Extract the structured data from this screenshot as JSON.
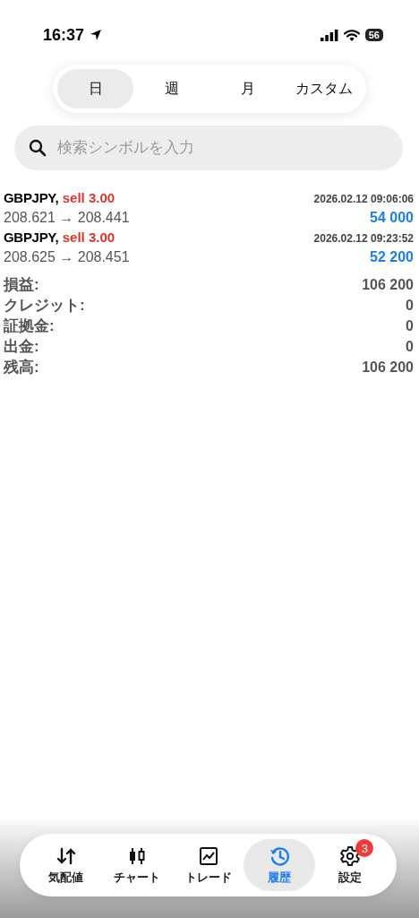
{
  "status_bar": {
    "time": "16:37",
    "battery": "56"
  },
  "period_tabs": [
    {
      "label": "日",
      "selected": true
    },
    {
      "label": "週",
      "selected": false
    },
    {
      "label": "月",
      "selected": false
    },
    {
      "label": "カスタム",
      "selected": false
    }
  ],
  "search": {
    "placeholder": "検索シンボルを入力"
  },
  "deals": [
    {
      "symbol": "GBPJPY,",
      "side": "sell 3.00",
      "time": "2026.02.12 09:06:06",
      "prices": "208.621 → 208.441",
      "profit": "54 000"
    },
    {
      "symbol": "GBPJPY,",
      "side": "sell 3.00",
      "time": "2026.02.12 09:23:52",
      "prices": "208.625 → 208.451",
      "profit": "52 200"
    }
  ],
  "summary": [
    {
      "label": "損益:",
      "value": "106 200"
    },
    {
      "label": "クレジット:",
      "value": "0"
    },
    {
      "label": "証拠金:",
      "value": "0"
    },
    {
      "label": "出金:",
      "value": "0"
    },
    {
      "label": "残高:",
      "value": "106 200"
    }
  ],
  "tab_bar": [
    {
      "kind": "quotes",
      "label": "気配値",
      "selected": false
    },
    {
      "kind": "chart",
      "label": "チャート",
      "selected": false
    },
    {
      "kind": "trade",
      "label": "トレード",
      "selected": false
    },
    {
      "kind": "history",
      "label": "履歴",
      "selected": true
    },
    {
      "kind": "settings",
      "label": "設定",
      "selected": false,
      "badge": "3"
    }
  ]
}
